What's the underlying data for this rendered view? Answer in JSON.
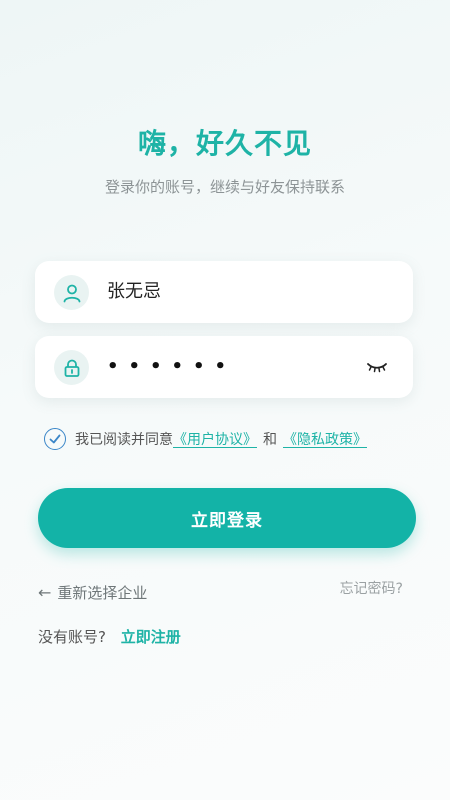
{
  "header": {
    "title": "嗨，好久不见",
    "subtitle": "登录你的账号，继续与好友保持联系"
  },
  "form": {
    "username_value": "张无忌",
    "password_mask": "••••••",
    "password_icon": "eye-closed-icon",
    "user_icon": "user-icon",
    "lock_icon": "lock-icon"
  },
  "agreement": {
    "checked": true,
    "prefix": "我已阅读并同意",
    "user_agreement": "《用户协议》",
    "and": "和",
    "privacy_policy": "《隐私政策》"
  },
  "actions": {
    "login_label": "立即登录",
    "reselect_label": "重新选择企业",
    "forgot_label": "忘记密码?",
    "no_account_label": "没有账号?",
    "register_label": "立即注册"
  },
  "colors": {
    "accent": "#13b3a7",
    "link": "#1eb3a6",
    "checkbox": "#3a86c8"
  }
}
